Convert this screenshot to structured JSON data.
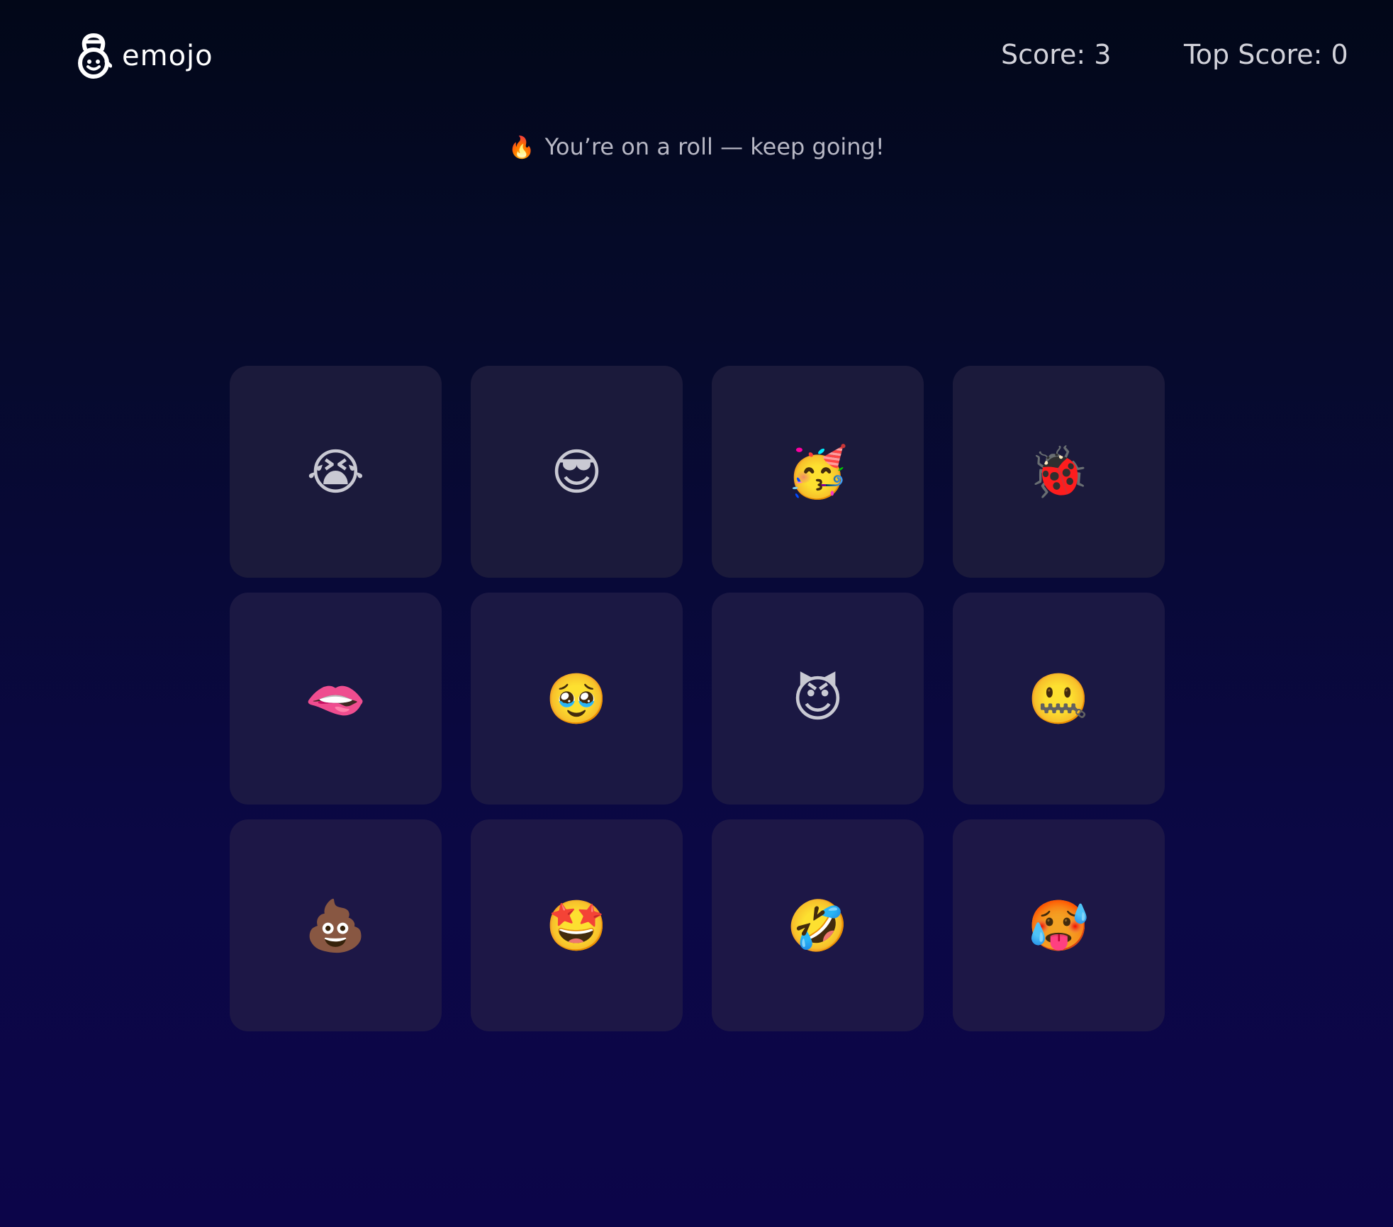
{
  "header": {
    "logo_text": "emojo",
    "logo_icon": "kettlebell-smiley-icon",
    "score_label": "Score: 3",
    "top_score_label": "Top Score: 0"
  },
  "status": {
    "icon": "🔥",
    "text": "You’re on a roll — keep going!"
  },
  "cards": [
    {
      "emoji": "😭",
      "name": "loudly-crying-face"
    },
    {
      "emoji": "😎",
      "name": "smiling-face-with-sunglasses"
    },
    {
      "emoji": "🥳",
      "name": "partying-face"
    },
    {
      "emoji": "🐞",
      "name": "lady-beetle"
    },
    {
      "emoji": "🫦",
      "name": "biting-lip"
    },
    {
      "emoji": "🥹",
      "name": "face-holding-back-tears"
    },
    {
      "emoji": "😈",
      "name": "smiling-face-with-horns"
    },
    {
      "emoji": "🤐",
      "name": "zipper-mouth-face"
    },
    {
      "emoji": "💩",
      "name": "pile-of-poo"
    },
    {
      "emoji": "🤩",
      "name": "star-struck"
    },
    {
      "emoji": "🤣",
      "name": "rolling-on-the-floor-laughing"
    },
    {
      "emoji": "🥵",
      "name": "hot-face"
    }
  ],
  "colors": {
    "card": "#1b1a3b",
    "background_top": "#020718",
    "background_bottom": "#0c0549",
    "text": "#d2d2da"
  }
}
